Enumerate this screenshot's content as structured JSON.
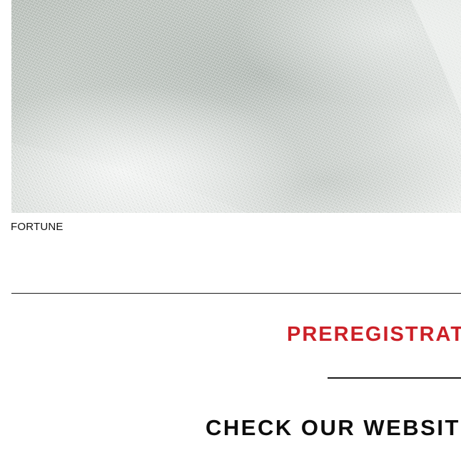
{
  "hero": {
    "image_subject": "knit-fabric-photo",
    "caption": "FORTUNE"
  },
  "preregistration": {
    "heading": "PREREGISTRATI",
    "color": "#cc2027"
  },
  "cta": {
    "heading": "CHECK OUR WEBSITE"
  }
}
